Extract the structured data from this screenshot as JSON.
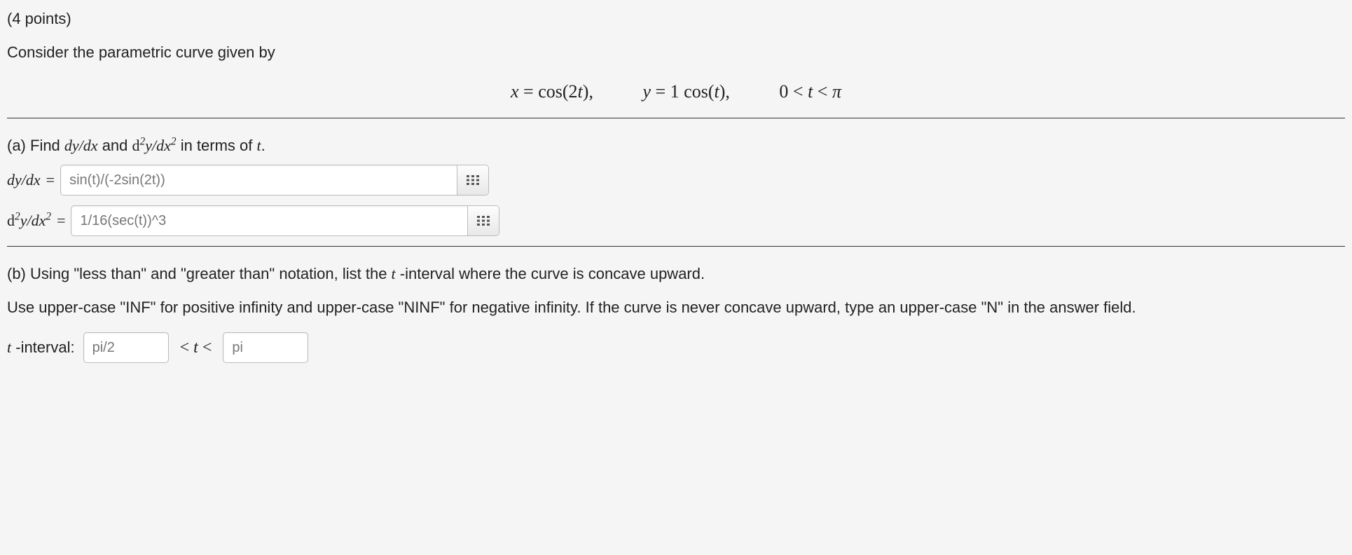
{
  "points": "(4 points)",
  "intro": "Consider the parametric curve given by",
  "equation": {
    "x": "x = cos(2t),",
    "y": "y = 1 cos(t),",
    "domain": "0 < t < π"
  },
  "partA": {
    "prompt_prefix": "(a) Find ",
    "prompt_mid": " and ",
    "prompt_suffix": " in terms of ",
    "prompt_end": ".",
    "dyDx_label": "dy/dx",
    "d2yDx2_label_pre": "d",
    "d2yDx2_label_mid": "y/dx",
    "t_label": "t",
    "eq": " = ",
    "input1": "sin(t)/(-2sin(2t))",
    "input2": "1/16(sec(t))^3"
  },
  "partB": {
    "line1": "(b) Using \"less than\" and \"greater than\" notation, list the t -interval where the curve is concave upward.",
    "line2": "Use upper-case \"INF\" for positive infinity and upper-case \"NINF\" for negative infinity. If the curve is never concave upward, type an upper-case \"N\" in the answer field.",
    "interval_label": "t -interval:",
    "lt": "<",
    "t": "t",
    "input_left": "pi/2",
    "input_right": "pi"
  }
}
